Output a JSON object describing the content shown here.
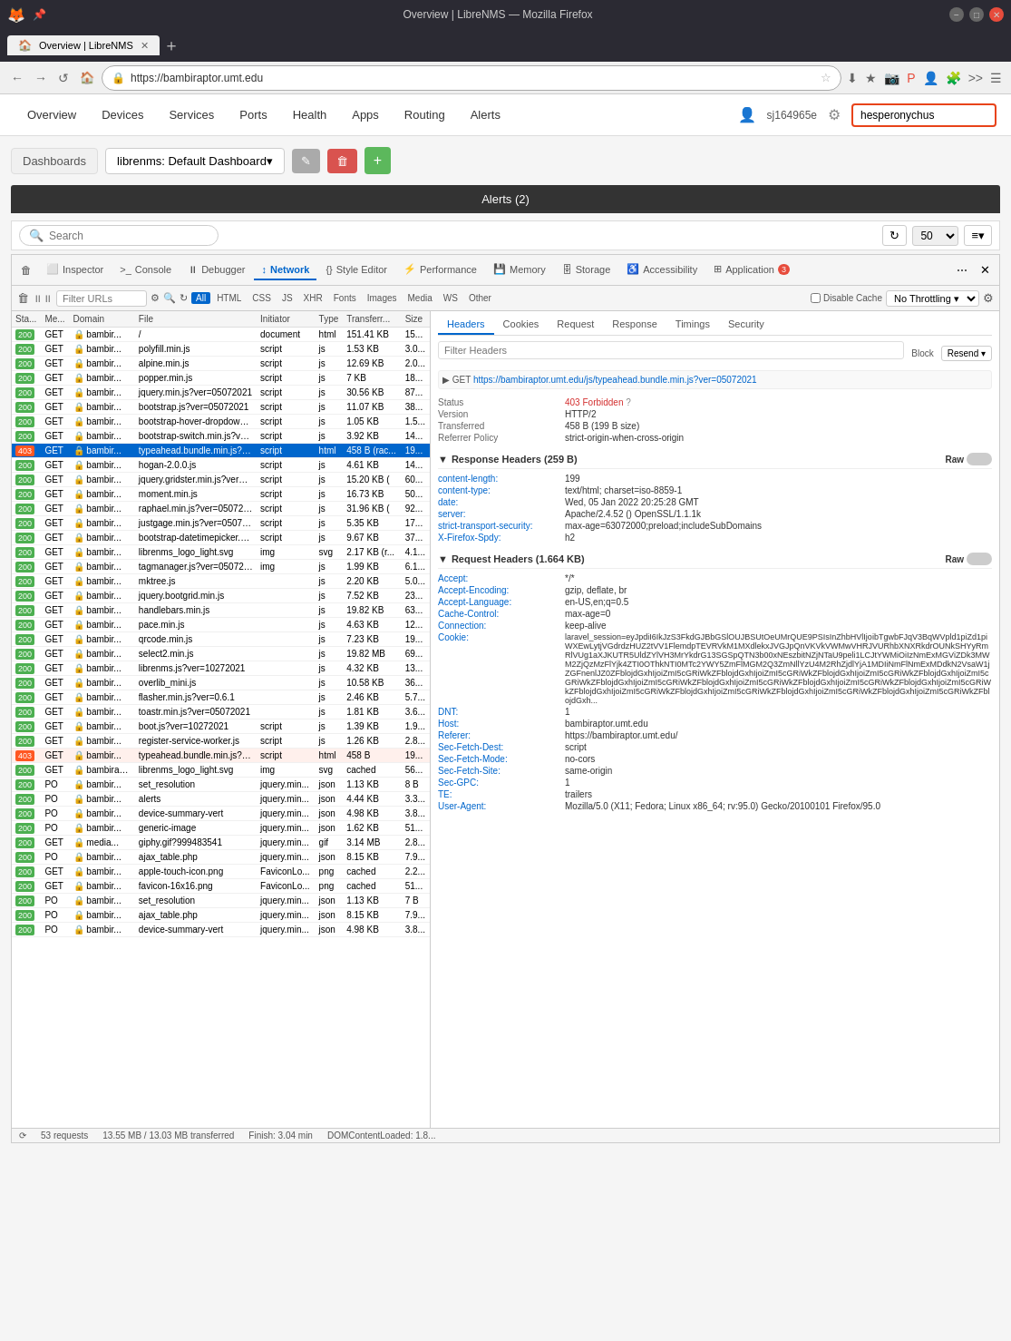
{
  "browser": {
    "title": "Overview | LibreNMS — Mozilla Firefox",
    "tab_label": "Overview | LibreNMS",
    "address": "https://bambiraptor.umt.edu",
    "back_btn": "←",
    "forward_btn": "→",
    "reload_btn": "↺"
  },
  "nav": {
    "items": [
      "Overview",
      "Devices",
      "Services",
      "Ports",
      "Health",
      "Apps",
      "Routing",
      "Alerts"
    ],
    "user": "sj164965e",
    "search_placeholder": "hesperonychus",
    "search_value": "hesperonychus"
  },
  "dashboard": {
    "label": "Dashboards",
    "select_value": "librenms: Default Dashboard▾",
    "edit_icon": "✎",
    "delete_icon": "🗑",
    "add_icon": "+"
  },
  "alerts_header": "Alerts (2)",
  "search": {
    "placeholder": "Search",
    "per_page": "50"
  },
  "devtools": {
    "tabs": [
      "Inspector",
      "Console",
      "Debugger",
      "Network",
      "Style Editor",
      "Performance",
      "Memory",
      "Storage",
      "Accessibility",
      "Application"
    ],
    "active_tab": "Network",
    "app_badge": "3",
    "filter_placeholder": "Filter URLs",
    "net_types": [
      "All",
      "HTML",
      "CSS",
      "JS",
      "XHR",
      "Fonts",
      "Images",
      "Media",
      "WS",
      "Other"
    ],
    "active_type": "All",
    "throttle": "No Throttling ▾",
    "disable_cache": "Disable Cache"
  },
  "net_columns": [
    "Sta...",
    "Me...",
    "Domain",
    "File",
    "Initiator",
    "Type",
    "Transferr...",
    "Size"
  ],
  "net_rows": [
    {
      "status": "200",
      "method": "GET",
      "domain": "bambir...",
      "file": "/",
      "initiator": "document",
      "type": "html",
      "transfer": "151.41 KB",
      "size": "15...",
      "is_selected": false,
      "is_403": false
    },
    {
      "status": "200",
      "method": "GET",
      "domain": "bambir...",
      "file": "polyfill.min.js",
      "initiator": "script",
      "type": "js",
      "transfer": "1.53 KB",
      "size": "3.0...",
      "is_selected": false,
      "is_403": false
    },
    {
      "status": "200",
      "method": "GET",
      "domain": "bambir...",
      "file": "alpine.min.js",
      "initiator": "script",
      "type": "js",
      "transfer": "12.69 KB",
      "size": "2.0...",
      "is_selected": false,
      "is_403": false
    },
    {
      "status": "200",
      "method": "GET",
      "domain": "bambir...",
      "file": "popper.min.js",
      "initiator": "script",
      "type": "js",
      "transfer": "7 KB",
      "size": "18...",
      "is_selected": false,
      "is_403": false
    },
    {
      "status": "200",
      "method": "GET",
      "domain": "bambir...",
      "file": "jquery.min.js?ver=05072021",
      "initiator": "script",
      "type": "js",
      "transfer": "30.56 KB",
      "size": "87...",
      "is_selected": false,
      "is_403": false
    },
    {
      "status": "200",
      "method": "GET",
      "domain": "bambir...",
      "file": "bootstrap.js?ver=05072021",
      "initiator": "script",
      "type": "js",
      "transfer": "11.07 KB",
      "size": "38...",
      "is_selected": false,
      "is_403": false
    },
    {
      "status": "200",
      "method": "GET",
      "domain": "bambir...",
      "file": "bootstrap-hover-dropdown.min.js",
      "initiator": "script",
      "type": "js",
      "transfer": "1.05 KB",
      "size": "1.5...",
      "is_selected": false,
      "is_403": false
    },
    {
      "status": "200",
      "method": "GET",
      "domain": "bambir...",
      "file": "bootstrap-switch.min.js?ver=050...",
      "initiator": "script",
      "type": "js",
      "transfer": "3.92 KB",
      "size": "14...",
      "is_selected": false,
      "is_403": false
    },
    {
      "status": "403",
      "method": "GET",
      "domain": "bambir...",
      "file": "typeahead.bundle.min.js?ver=050",
      "initiator": "script",
      "type": "html",
      "transfer": "458 B (rac...",
      "size": "19...",
      "is_selected": true,
      "is_403": false
    },
    {
      "status": "200",
      "method": "GET",
      "domain": "bambir...",
      "file": "hogan-2.0.0.js",
      "initiator": "script",
      "type": "js",
      "transfer": "4.61 KB",
      "size": "14...",
      "is_selected": false,
      "is_403": false
    },
    {
      "status": "200",
      "method": "GET",
      "domain": "bambir...",
      "file": "jquery.gridster.min.js?ver=05072...",
      "initiator": "script",
      "type": "js",
      "transfer": "15.20 KB (",
      "size": "60...",
      "is_selected": false,
      "is_403": false
    },
    {
      "status": "200",
      "method": "GET",
      "domain": "bambir...",
      "file": "moment.min.js",
      "initiator": "script",
      "type": "js",
      "transfer": "16.73 KB",
      "size": "50...",
      "is_selected": false,
      "is_403": false
    },
    {
      "status": "200",
      "method": "GET",
      "domain": "bambir...",
      "file": "raphael.min.js?ver=05072021",
      "initiator": "script",
      "type": "js",
      "transfer": "31.96 KB (",
      "size": "92...",
      "is_selected": false,
      "is_403": false
    },
    {
      "status": "200",
      "method": "GET",
      "domain": "bambir...",
      "file": "justgage.min.js?ver=05072021",
      "initiator": "script",
      "type": "js",
      "transfer": "5.35 KB",
      "size": "17...",
      "is_selected": false,
      "is_403": false
    },
    {
      "status": "200",
      "method": "GET",
      "domain": "bambir...",
      "file": "bootstrap-datetimepicker.min.js?",
      "initiator": "script",
      "type": "js",
      "transfer": "9.67 KB",
      "size": "37...",
      "is_selected": false,
      "is_403": false
    },
    {
      "status": "200",
      "method": "GET",
      "domain": "bambir...",
      "file": "librenms_logo_light.svg",
      "initiator": "img",
      "type": "svg",
      "transfer": "2.17 KB (r...",
      "size": "4.1...",
      "is_selected": false,
      "is_403": false
    },
    {
      "status": "200",
      "method": "GET",
      "domain": "bambir...",
      "file": "tagmanager.js?ver=05072021",
      "initiator": "img",
      "type": "js",
      "transfer": "1.99 KB",
      "size": "6.1...",
      "is_selected": false,
      "is_403": false
    },
    {
      "status": "200",
      "method": "GET",
      "domain": "bambir...",
      "file": "mktree.js",
      "initiator": "",
      "type": "js",
      "transfer": "2.20 KB",
      "size": "5.0...",
      "is_selected": false,
      "is_403": false
    },
    {
      "status": "200",
      "method": "GET",
      "domain": "bambir...",
      "file": "jquery.bootgrid.min.js",
      "initiator": "",
      "type": "js",
      "transfer": "7.52 KB",
      "size": "23...",
      "is_selected": false,
      "is_403": false
    },
    {
      "status": "200",
      "method": "GET",
      "domain": "bambir...",
      "file": "handlebars.min.js",
      "initiator": "",
      "type": "js",
      "transfer": "19.82 KB",
      "size": "63...",
      "is_selected": false,
      "is_403": false
    },
    {
      "status": "200",
      "method": "GET",
      "domain": "bambir...",
      "file": "pace.min.js",
      "initiator": "",
      "type": "js",
      "transfer": "4.63 KB",
      "size": "12...",
      "is_selected": false,
      "is_403": false
    },
    {
      "status": "200",
      "method": "GET",
      "domain": "bambir...",
      "file": "qrcode.min.js",
      "initiator": "",
      "type": "js",
      "transfer": "7.23 KB",
      "size": "19...",
      "is_selected": false,
      "is_403": false
    },
    {
      "status": "200",
      "method": "GET",
      "domain": "bambir...",
      "file": "select2.min.js",
      "initiator": "",
      "type": "js",
      "transfer": "19.82 MB",
      "size": "69...",
      "is_selected": false,
      "is_403": false
    },
    {
      "status": "200",
      "method": "GET",
      "domain": "bambir...",
      "file": "librenms.js?ver=10272021",
      "initiator": "",
      "type": "js",
      "transfer": "4.32 KB",
      "size": "13...",
      "is_selected": false,
      "is_403": false
    },
    {
      "status": "200",
      "method": "GET",
      "domain": "bambir...",
      "file": "overlib_mini.js",
      "initiator": "",
      "type": "js",
      "transfer": "10.58 KB",
      "size": "36...",
      "is_selected": false,
      "is_403": false
    },
    {
      "status": "200",
      "method": "GET",
      "domain": "bambir...",
      "file": "flasher.min.js?ver=0.6.1",
      "initiator": "",
      "type": "js",
      "transfer": "2.46 KB",
      "size": "5.7...",
      "is_selected": false,
      "is_403": false
    },
    {
      "status": "200",
      "method": "GET",
      "domain": "bambir...",
      "file": "toastr.min.js?ver=05072021",
      "initiator": "",
      "type": "js",
      "transfer": "1.81 KB",
      "size": "3.6...",
      "is_selected": false,
      "is_403": false
    },
    {
      "status": "200",
      "method": "GET",
      "domain": "bambir...",
      "file": "boot.js?ver=10272021",
      "initiator": "script",
      "type": "js",
      "transfer": "1.39 KB",
      "size": "1.9...",
      "is_selected": false,
      "is_403": false
    },
    {
      "status": "200",
      "method": "GET",
      "domain": "bambir...",
      "file": "register-service-worker.js",
      "initiator": "script",
      "type": "js",
      "transfer": "1.26 KB",
      "size": "2.8...",
      "is_selected": false,
      "is_403": false
    },
    {
      "status": "403",
      "method": "GET",
      "domain": "bambir...",
      "file": "typeahead.bundle.min.js?ver=050",
      "initiator": "script",
      "type": "html",
      "transfer": "458 B",
      "size": "19...",
      "is_selected": false,
      "is_403": true
    },
    {
      "status": "200",
      "method": "GET",
      "domain": "bambirap...",
      "file": "librenms_logo_light.svg",
      "initiator": "img",
      "type": "svg",
      "transfer": "cached",
      "size": "56...",
      "is_selected": false,
      "is_403": false
    },
    {
      "status": "200",
      "method": "PO",
      "domain": "bambir...",
      "file": "set_resolution",
      "initiator": "jquery.min...",
      "type": "json",
      "transfer": "1.13 KB",
      "size": "8 B",
      "is_selected": false,
      "is_403": false
    },
    {
      "status": "200",
      "method": "PO",
      "domain": "bambir...",
      "file": "alerts",
      "initiator": "jquery.min...",
      "type": "json",
      "transfer": "4.44 KB",
      "size": "3.3...",
      "is_selected": false,
      "is_403": false
    },
    {
      "status": "200",
      "method": "PO",
      "domain": "bambir...",
      "file": "device-summary-vert",
      "initiator": "jquery.min...",
      "type": "json",
      "transfer": "4.98 KB",
      "size": "3.8...",
      "is_selected": false,
      "is_403": false
    },
    {
      "status": "200",
      "method": "PO",
      "domain": "bambir...",
      "file": "generic-image",
      "initiator": "jquery.min...",
      "type": "json",
      "transfer": "1.62 KB",
      "size": "51...",
      "is_selected": false,
      "is_403": false
    },
    {
      "status": "200",
      "method": "GET",
      "domain": "media...",
      "file": "giphy.gif?999483541",
      "initiator": "jquery.min...",
      "type": "gif",
      "transfer": "3.14 MB",
      "size": "2.8...",
      "is_selected": false,
      "is_403": false
    },
    {
      "status": "200",
      "method": "PO",
      "domain": "bambir...",
      "file": "ajax_table.php",
      "initiator": "jquery.min...",
      "type": "json",
      "transfer": "8.15 KB",
      "size": "7.9...",
      "is_selected": false,
      "is_403": false
    },
    {
      "status": "200",
      "method": "GET",
      "domain": "bambir...",
      "file": "apple-touch-icon.png",
      "initiator": "FaviconLo...",
      "type": "png",
      "transfer": "cached",
      "size": "2.2...",
      "is_selected": false,
      "is_403": false
    },
    {
      "status": "200",
      "method": "GET",
      "domain": "bambir...",
      "file": "favicon-16x16.png",
      "initiator": "FaviconLo...",
      "type": "png",
      "transfer": "cached",
      "size": "51...",
      "is_selected": false,
      "is_403": false
    },
    {
      "status": "200",
      "method": "PO",
      "domain": "bambir...",
      "file": "set_resolution",
      "initiator": "jquery.min...",
      "type": "json",
      "transfer": "1.13 KB",
      "size": "7 B",
      "is_selected": false,
      "is_403": false
    },
    {
      "status": "200",
      "method": "PO",
      "domain": "bambir...",
      "file": "ajax_table.php",
      "initiator": "jquery.min...",
      "type": "json",
      "transfer": "8.15 KB",
      "size": "7.9...",
      "is_selected": false,
      "is_403": false
    },
    {
      "status": "200",
      "method": "PO",
      "domain": "bambir...",
      "file": "device-summary-vert",
      "initiator": "jquery.min...",
      "type": "json",
      "transfer": "4.98 KB",
      "size": "3.8...",
      "is_selected": false,
      "is_403": false
    }
  ],
  "headers_panel": {
    "tabs": [
      "Headers",
      "Cookies",
      "Request",
      "Response",
      "Timings",
      "Security"
    ],
    "active_tab": "Headers",
    "filter_placeholder": "Filter Headers",
    "block_label": "Block",
    "resend_label": "Resend ▾",
    "request_url": "GET https://bambiraptor.umt.edu/js/typeahead.bundle.min.js?ver=05072021",
    "status_section": {
      "title": "",
      "rows": [
        {
          "name": "Status",
          "value": "403 Forbidden",
          "color": "red"
        },
        {
          "name": "Version",
          "value": "HTTP/2"
        },
        {
          "name": "Transferred",
          "value": "458 B (199 B size)"
        },
        {
          "name": "Referrer Policy",
          "value": "strict-origin-when-cross-origin"
        }
      ]
    },
    "response_headers": {
      "title": "Response Headers (259 B)",
      "raw": "Raw",
      "items": [
        {
          "name": "content-length:",
          "value": "199"
        },
        {
          "name": "content-type:",
          "value": "text/html; charset=iso-8859-1"
        },
        {
          "name": "date:",
          "value": "Wed, 05 Jan 2022 20:25:28 GMT"
        },
        {
          "name": "server:",
          "value": "Apache/2.4.52 () OpenSSL/1.1.1k"
        },
        {
          "name": "strict-transport-security:",
          "value": "max-age=63072000;preload;includeSubDomains"
        },
        {
          "name": "X-Firefox-Spdy:",
          "value": "h2"
        }
      ]
    },
    "request_headers": {
      "title": "Request Headers (1.664 KB)",
      "raw": "Raw",
      "items": [
        {
          "name": "Accept:",
          "value": "*/*"
        },
        {
          "name": "Accept-Encoding:",
          "value": "gzip, deflate, br"
        },
        {
          "name": "Accept-Language:",
          "value": "en-US,en;q=0.5"
        },
        {
          "name": "Cache-Control:",
          "value": "max-age=0"
        },
        {
          "name": "Connection:",
          "value": "keep-alive"
        },
        {
          "name": "Cookie:",
          "value": "laravel_session=eyJpdilI6lkJzS3FkdGJBbGSlOUJBSUtOeUMrQUE9PSIsInZhbHVlIjoibTgwbFJqV3BqWVpld1piZd1piWXEwLytjVGdrdzHUZ2tVV1FlemdpTEVRVkM1MXdlekxJVGJpQnVKVkVWMwVHRJVURhbXNXRkdrOUNkSHYyRmRlVUg1aXJKUTR5UldZlVH3MrYkdrG13SGSpQTN3b00xNE5s3bitNZjNTaU9peli1LCJtYWMiOiIzNmExMGViZDk3MWM2ZjQzMzFlYjk4ZTI0OThkNTI0MTc2YWY5ZmFlMGM2Q3ZmNllYzU4M2RhZjdlYjA1MDIiNmFlNmExMDdkN2VsaW1jZGFnenlJZ0ZFblojdGlhIjoiZmI5cGRiWkZFblojdGlhIjoiZmI5cGRiWkZFblojdGlhIjoiZmI5cGRiWkZFblojdGlhIjoiZmI5cGRiWkZFblojdGlhIjoiZmI5cGRiWkZFblojdGlhIjoiZmI5cGRiWkZFblojdGlhIjoiZmI5cGRiWkZFblojdGlhIjoiZmI5cGRiWkZFblojdGlhIjoiZmI5cGRiWkZFblojdGlhIjoiZmI5cGRiWkZFblojdGlhIjoiZmI5cGRiWkZFblojdGlhIjoiZmI5cGRiWkZFblojdGlh..."
        },
        {
          "name": "DNT:",
          "value": "1"
        },
        {
          "name": "Host:",
          "value": "bambiraptor.umt.edu"
        },
        {
          "name": "Referer:",
          "value": "https://bambiraptor.umt.edu/"
        },
        {
          "name": "Sec-Fetch-Dest:",
          "value": "script"
        },
        {
          "name": "Sec-Fetch-Mode:",
          "value": "no-cors"
        },
        {
          "name": "Sec-Fetch-Site:",
          "value": "same-origin"
        },
        {
          "name": "Sec-GPC:",
          "value": "1"
        },
        {
          "name": "TE:",
          "value": "trailers"
        },
        {
          "name": "User-Agent:",
          "value": "Mozilla/5.0 (X11; Fedora; Linux x86_64; rv:95.0) Gecko/20100101 Firefox/95.0"
        }
      ]
    }
  },
  "statusbar": {
    "requests": "53 requests",
    "size": "13.55 MB / 13.03 MB transferred",
    "finish": "Finish: 3.04 min",
    "dom_content": "DOMContentLoaded: 1.8..."
  }
}
